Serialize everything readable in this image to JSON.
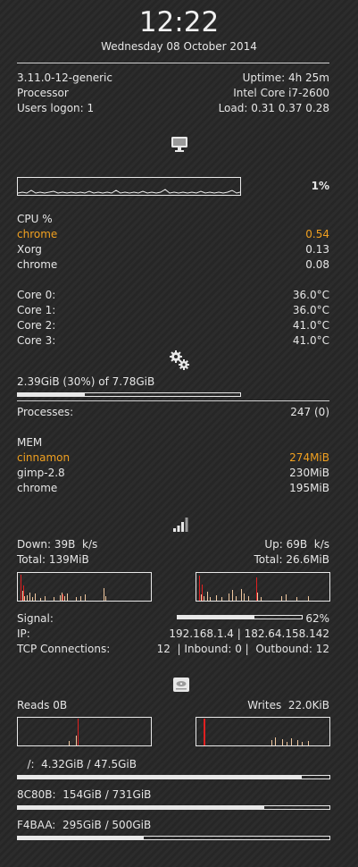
{
  "clock": {
    "time": "12:22",
    "date": "Wednesday 08 October 2014"
  },
  "system": {
    "kernel": "3.11.0-12-generic",
    "uptime": "Uptime: 4h 25m",
    "processor_label": "Processor",
    "processor_value": "Intel Core i7-2600",
    "users": "Users logon: 1",
    "load": "Load: 0.31 0.37 0.28"
  },
  "cpu": {
    "icon": "monitor-icon",
    "usage": "1%",
    "usage_fraction": 0.01,
    "header": "CPU %",
    "top": [
      {
        "name": "chrome",
        "value": "0.54",
        "highlight": true
      },
      {
        "name": "Xorg",
        "value": "0.13",
        "highlight": false
      },
      {
        "name": "chrome",
        "value": "0.08",
        "highlight": false
      }
    ],
    "cores": [
      {
        "label": "Core 0:",
        "temp": "36.0°C"
      },
      {
        "label": "Core 1:",
        "temp": "36.0°C"
      },
      {
        "label": "Core 2:",
        "temp": "41.0°C"
      },
      {
        "label": "Core 3:",
        "temp": "41.0°C"
      }
    ]
  },
  "memory": {
    "icon": "gears-icon",
    "summary": "2.39GiB (30%) of 7.78GiB",
    "usage_fraction": 0.3,
    "processes_label": "Processes:",
    "processes_value": "247 (0)",
    "header": "MEM",
    "top": [
      {
        "name": "cinnamon",
        "value": "274MiB",
        "highlight": true
      },
      {
        "name": "gimp-2.8",
        "value": "230MiB",
        "highlight": false
      },
      {
        "name": "chrome",
        "value": "195MiB",
        "highlight": false
      }
    ]
  },
  "network": {
    "icon": "signal-bars-icon",
    "down": "Down: 39B  k/s",
    "up": "Up: 69B  k/s",
    "total_down": "Total: 139MiB",
    "total_up": "Total: 26.6MiB",
    "signal_label": "Signal:",
    "signal_value": "62%",
    "signal_fraction": 0.62,
    "ip_label": "IP:",
    "ip_value": "192.168.1.4 | 182.64.158.142",
    "tcp_label": "TCP Connections:",
    "tcp_value": "12  | Inbound: 0 |  Outbound: 12"
  },
  "disk": {
    "icon": "hard-disk-icon",
    "reads": "Reads 0B",
    "writes": "Writes  22.0KiB",
    "volumes": [
      {
        "label": "   /:  4.32GiB / 47.5GiB",
        "fraction": 0.91
      },
      {
        "label": "8C80B:  154GiB / 731GiB",
        "fraction": 0.79
      },
      {
        "label": "F4BAA:  295GiB / 500GiB",
        "fraction": 0.405
      }
    ]
  },
  "colors": {
    "accent": "#f0a020",
    "foreground": "#e6e6e6",
    "spike_red": "#e02020",
    "spike_pale": "#f0c8a0"
  }
}
